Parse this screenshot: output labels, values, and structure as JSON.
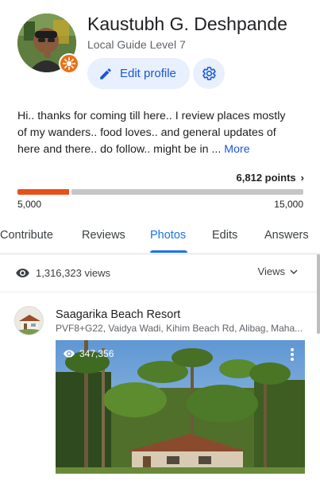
{
  "profile": {
    "name": "Kaustubh G. Deshpande",
    "level": "Local Guide Level 7",
    "edit_label": "Edit profile",
    "bio": "Hi.. thanks for coming till here.. I review places mostly of my wanders.. food loves.. and general updates of here and there.. do follow.. might be in ... ",
    "bio_more": "More"
  },
  "points": {
    "label": "6,812 points",
    "min_label": "5,000",
    "max_label": "15,000",
    "min": 5000,
    "max": 15000,
    "value": 6812
  },
  "tabs": [
    {
      "label": "Contribute"
    },
    {
      "label": "Reviews"
    },
    {
      "label": "Photos"
    },
    {
      "label": "Edits"
    },
    {
      "label": "Answers"
    }
  ],
  "views": {
    "count": "1,316,323 views",
    "sort_label": "Views"
  },
  "place": {
    "name": "Saagarika Beach Resort",
    "address": "PVF8+G22, Vaidya Wadi, Kihim Beach Rd, Alibag, Maha...",
    "photo_views": "347,356"
  },
  "colors": {
    "accent": "#1a73e8",
    "progress": "#e8501a",
    "badge": "#e8711a"
  }
}
